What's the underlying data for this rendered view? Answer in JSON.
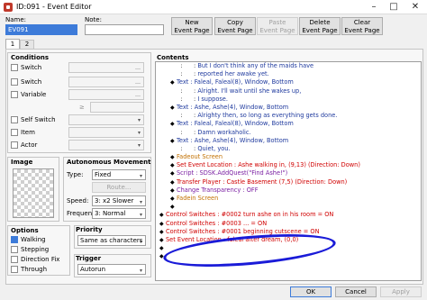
{
  "window": {
    "title": "ID:091 - Event Editor"
  },
  "header": {
    "name_label": "Name:",
    "name_value": "EV091",
    "note_label": "Note:",
    "note_value": ""
  },
  "toolbar": {
    "new_page": [
      "New",
      "Event Page"
    ],
    "copy_page": [
      "Copy",
      "Event Page"
    ],
    "paste_page": [
      "Paste",
      "Event Page"
    ],
    "delete_page": [
      "Delete",
      "Event Page"
    ],
    "clear_page": [
      "Clear",
      "Event Page"
    ]
  },
  "tabs": [
    "1",
    "2"
  ],
  "conditions": {
    "title": "Conditions",
    "switch1": "Switch",
    "switch2": "Switch",
    "variable": "Variable",
    "ge": "≥",
    "self_switch": "Self Switch",
    "item": "Item",
    "actor": "Actor"
  },
  "image": {
    "title": "Image"
  },
  "autonomous": {
    "title": "Autonomous Movement",
    "type_label": "Type:",
    "type_value": "Fixed",
    "route_label": "Route...",
    "speed_label": "Speed:",
    "speed_value": "3: x2 Slower",
    "freq_label": "Frequency:",
    "freq_value": "3: Normal"
  },
  "options": {
    "title": "Options",
    "walking": "Walking",
    "stepping": "Stepping",
    "direction_fix": "Direction Fix",
    "through": "Through"
  },
  "priority": {
    "title": "Priority",
    "value": "Same as characters"
  },
  "trigger": {
    "title": "Trigger",
    "value": "Autorun"
  },
  "contents": {
    "title": "Contents",
    "lines": [
      {
        "pre": "  :      : ",
        "text": "But I don't think any of the maids have",
        "color": "c-blue",
        "level": 1,
        "mark": ""
      },
      {
        "pre": "  :      : ",
        "text": "reported her awake yet.",
        "color": "c-blue",
        "level": 1,
        "mark": ""
      },
      {
        "pre": "",
        "text": "Text : Faleal, Faleal(8), Window, Bottom",
        "color": "c-blue",
        "level": 1,
        "mark": "◆"
      },
      {
        "pre": "  :      : ",
        "text": "Alright. I'll wait until she wakes up,",
        "color": "c-blue",
        "level": 1,
        "mark": ""
      },
      {
        "pre": "  :      : ",
        "text": "I suppose.",
        "color": "c-blue",
        "level": 1,
        "mark": ""
      },
      {
        "pre": "",
        "text": "Text : Ashe, Ashe(4), Window, Bottom",
        "color": "c-blue",
        "level": 1,
        "mark": "◆"
      },
      {
        "pre": "  :      : ",
        "text": "Alrighty then, so long as everything gets done.",
        "color": "c-blue",
        "level": 1,
        "mark": ""
      },
      {
        "pre": "",
        "text": "Text : Faleal, Faleal(8), Window, Bottom",
        "color": "c-blue",
        "level": 1,
        "mark": "◆"
      },
      {
        "pre": "  :      : ",
        "text": "Damn workaholic.",
        "color": "c-blue",
        "level": 1,
        "mark": ""
      },
      {
        "pre": "",
        "text": "Text : Ashe, Ashe(4), Window, Bottom",
        "color": "c-blue",
        "level": 1,
        "mark": "◆"
      },
      {
        "pre": "  :      : ",
        "text": "Quiet, you.",
        "color": "c-blue",
        "level": 1,
        "mark": ""
      },
      {
        "pre": "",
        "text": "Fadeout Screen",
        "color": "c-orange",
        "level": 1,
        "mark": "◆"
      },
      {
        "pre": "",
        "text": "Set Event Location : Ashe walking in, (9,13) (Direction: Down)",
        "color": "c-red",
        "level": 1,
        "mark": "◆"
      },
      {
        "pre": "",
        "text": "Script : SDSK.AddQuest(\"Find Ashe!\")",
        "color": "c-purple",
        "level": 1,
        "mark": "◆"
      },
      {
        "pre": "",
        "text": "Transfer Player : Castle Basement (7,5) (Direction: Down)",
        "color": "c-red",
        "level": 1,
        "mark": "◆"
      },
      {
        "pre": "",
        "text": "Change Transparency : OFF",
        "color": "c-purple",
        "level": 1,
        "mark": "◆"
      },
      {
        "pre": "",
        "text": "Fadein Screen",
        "color": "c-orange",
        "level": 1,
        "mark": "◆"
      },
      {
        "pre": "",
        "text": "",
        "color": "c-black",
        "level": 1,
        "mark": "◆"
      },
      {
        "pre": "",
        "text": "Control Switches : #0002 turn ashe on in his room = ON",
        "color": "c-red",
        "level": 0,
        "mark": "◆"
      },
      {
        "pre": "",
        "text": "Control Switches : #0003 ... = ON",
        "color": "c-red",
        "level": 0,
        "mark": "◆"
      },
      {
        "pre": "",
        "text": "Control Switches : #0001 beginning cutscene = ON",
        "color": "c-red",
        "level": 0,
        "mark": "◆"
      },
      {
        "pre": "",
        "text": "Set Event Location : faleal after dream, (0,0)",
        "color": "c-red",
        "level": 0,
        "mark": "◆"
      },
      {
        "pre": "",
        "text": "",
        "color": "c-black",
        "level": 0,
        "mark": "◆"
      },
      {
        "pre": "",
        "text": "",
        "color": "c-black",
        "level": 0,
        "mark": "◆"
      }
    ]
  },
  "footer": {
    "ok": "OK",
    "cancel": "Cancel",
    "apply": "Apply"
  }
}
